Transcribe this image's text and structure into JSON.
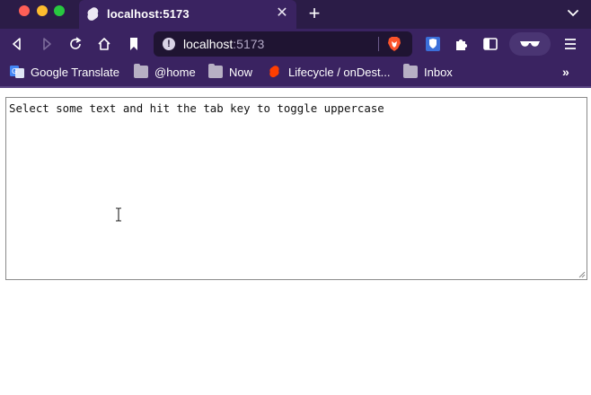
{
  "browser": {
    "tab": {
      "title": "localhost:5173",
      "close_glyph": "✕"
    },
    "new_tab_glyph": "+",
    "address": {
      "host": "localhost",
      "port": ":5173",
      "info_glyph": "!"
    },
    "bookmarks": [
      {
        "label": "Google Translate",
        "icon": "google-translate-icon"
      },
      {
        "label": "@home",
        "icon": "folder-icon"
      },
      {
        "label": "Now",
        "icon": "folder-icon"
      },
      {
        "label": "Lifecycle / onDest...",
        "icon": "svelte-icon"
      },
      {
        "label": "Inbox",
        "icon": "folder-icon"
      }
    ],
    "bookmarks_overflow_glyph": "»",
    "colors": {
      "chrome": "#3a2361",
      "tabstrip": "#2b1c47",
      "urlbar": "#1f1432"
    }
  },
  "page": {
    "editor_text": "Select some text and hit the tab key to toggle uppercase"
  }
}
